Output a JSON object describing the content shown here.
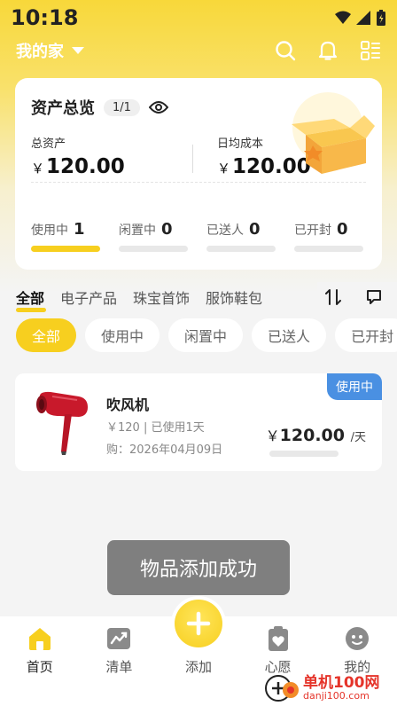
{
  "status_bar": {
    "time": "10:18"
  },
  "header": {
    "home_title": "我的家"
  },
  "asset_card": {
    "title": "资产总览",
    "page": "1/1",
    "total_label": "总资产",
    "total_currency": "￥",
    "total_value": "120.00",
    "daily_label": "日均成本",
    "daily_currency": "￥",
    "daily_value": "120.00",
    "status_tabs": [
      {
        "label": "使用中",
        "count": "1"
      },
      {
        "label": "闲置中",
        "count": "0"
      },
      {
        "label": "已送人",
        "count": "0"
      },
      {
        "label": "已开封",
        "count": "0"
      }
    ]
  },
  "categories": [
    "全部",
    "电子产品",
    "珠宝首饰",
    "服饰鞋包"
  ],
  "filters": [
    "全部",
    "使用中",
    "闲置中",
    "已送人",
    "已开封"
  ],
  "item": {
    "status": "使用中",
    "name": "吹风机",
    "sub": "￥120 | 已使用1天",
    "date": "购：2026年04月09日",
    "currency": "￥",
    "price": "120.00",
    "unit": "/天"
  },
  "toast": "物品添加成功",
  "nav": [
    {
      "label": "首页",
      "icon": "home-icon"
    },
    {
      "label": "清单",
      "icon": "chart-icon"
    },
    {
      "label": "添加",
      "icon": "add-icon"
    },
    {
      "label": "心愿",
      "icon": "wish-icon"
    },
    {
      "label": "我的",
      "icon": "profile-icon"
    }
  ],
  "watermark": {
    "main": "单机100网",
    "sub": "danji100.com"
  },
  "colors": {
    "accent": "#f7cf1f",
    "status_blue": "#4a90e2"
  }
}
